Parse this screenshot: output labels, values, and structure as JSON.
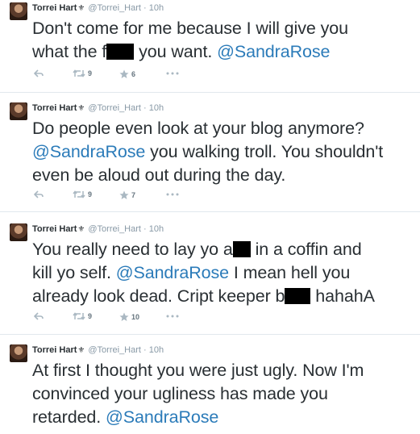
{
  "tweets": [
    {
      "name": "Torrei Hart",
      "verified_glyph": "⚜",
      "handle": "@Torrei_Hart",
      "separator": "·",
      "time": "10h",
      "text_parts": [
        "Don't come for me because I will give you",
        "what the f",
        "you want.",
        "@SandraRose"
      ],
      "retweets": "9",
      "favorites": "6"
    },
    {
      "name": "Torrei Hart",
      "verified_glyph": "⚜",
      "handle": "@Torrei_Hart",
      "separator": "·",
      "time": "10h",
      "text_parts": [
        "Do people even look at your blog anymore?",
        "@SandraRose",
        "you walking troll. You shouldn't",
        "even be aloud out during the day."
      ],
      "retweets": "9",
      "favorites": "7"
    },
    {
      "name": "Torrei Hart",
      "verified_glyph": "⚜",
      "handle": "@Torrei_Hart",
      "separator": "·",
      "time": "10h",
      "text_parts": [
        "You really need to lay yo a",
        "in a coffin and",
        "kill yo self.",
        "@SandraRose",
        "I mean hell you",
        "already look dead. Cript keeper b",
        "hahahA"
      ],
      "retweets": "9",
      "favorites": "10"
    },
    {
      "name": "Torrei Hart",
      "verified_glyph": "⚜",
      "handle": "@Torrei_Hart",
      "separator": "·",
      "time": "10h",
      "text_parts": [
        "At first I thought you were just ugly. Now I'm",
        "convinced your ugliness has made you",
        "retarded.",
        "@SandraRose"
      ]
    }
  ],
  "icons": {
    "reply": "reply-icon",
    "retweet": "retweet-icon",
    "favorite": "star-icon",
    "more": "more-icon"
  },
  "colors": {
    "mention": "#2b7bb9",
    "text": "#292f33",
    "meta": "#8899a6",
    "divider": "#e1e8ed"
  }
}
